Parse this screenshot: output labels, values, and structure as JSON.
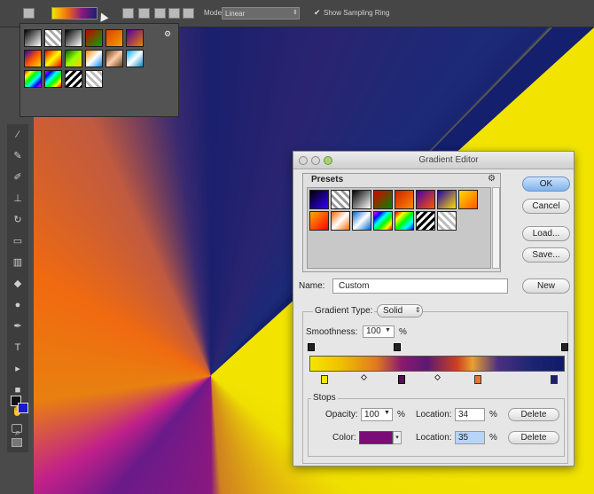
{
  "options_bar": {
    "mode_label": "Mode:",
    "mode_value": "Linear",
    "show_sampling_ring_checked": true,
    "show_sampling_ring_label": "Show Sampling Ring"
  },
  "tools_icons": [
    "eyedropper-icon",
    "brush-icon",
    "pencil-icon",
    "stamp-icon",
    "history-brush-icon",
    "eraser-icon",
    "gradient-icon",
    "blur-icon",
    "dodge-icon",
    "pen-icon",
    "type-icon",
    "path-select-icon",
    "shape-icon",
    "hand-icon",
    "zoom-icon"
  ],
  "colors": {
    "foreground": "#111111",
    "background": "#1a1acc",
    "accent_ok": "#7fb3ec"
  },
  "gradient_editor": {
    "title": "Gradient Editor",
    "presets_label": "Presets",
    "buttons": {
      "ok": "OK",
      "cancel": "Cancel",
      "load": "Load...",
      "save": "Save...",
      "new": "New"
    },
    "name_label": "Name:",
    "name_value": "Custom",
    "gradient_type_label": "Gradient Type:",
    "gradient_type_value": "Solid",
    "smoothness_label": "Smoothness:",
    "smoothness_value": "100",
    "smoothness_unit": "%",
    "stops_label": "Stops",
    "opacity_label": "Opacity:",
    "opacity_value": "100",
    "opacity_unit": "%",
    "opacity_location_label": "Location:",
    "opacity_location_value": "34",
    "opacity_location_unit": "%",
    "opacity_delete": "Delete",
    "color_label": "Color:",
    "color_value": "#7a0c78",
    "color_location_label": "Location:",
    "color_location_value": "35",
    "color_location_unit": "%",
    "color_delete": "Delete"
  }
}
